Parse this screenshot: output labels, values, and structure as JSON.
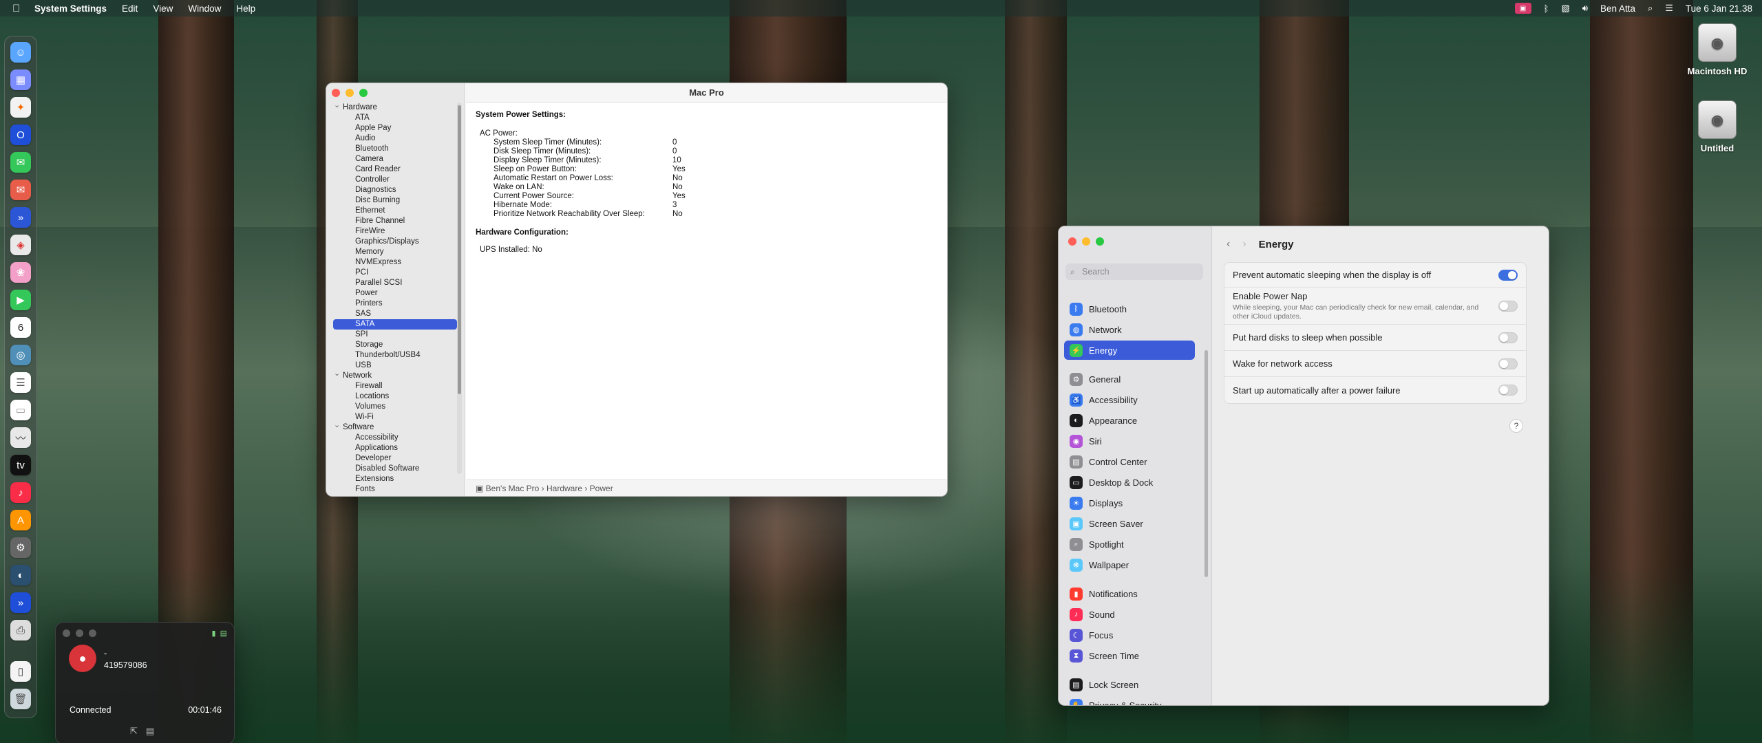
{
  "menubar": {
    "app_name": "System Settings",
    "menus": [
      "Edit",
      "View",
      "Window",
      "Help"
    ],
    "user": "Ben Atta",
    "datetime": "Tue 6 Jan  21.38"
  },
  "desktop": {
    "disks": [
      "Macintosh HD",
      "Untitled"
    ]
  },
  "sysinfo": {
    "title": "Mac Pro",
    "tree": [
      {
        "type": "grp",
        "label": "Hardware"
      },
      {
        "type": "leaf",
        "label": "ATA"
      },
      {
        "type": "leaf",
        "label": "Apple Pay"
      },
      {
        "type": "leaf",
        "label": "Audio"
      },
      {
        "type": "leaf",
        "label": "Bluetooth"
      },
      {
        "type": "leaf",
        "label": "Camera"
      },
      {
        "type": "leaf",
        "label": "Card Reader"
      },
      {
        "type": "leaf",
        "label": "Controller"
      },
      {
        "type": "leaf",
        "label": "Diagnostics"
      },
      {
        "type": "leaf",
        "label": "Disc Burning"
      },
      {
        "type": "leaf",
        "label": "Ethernet"
      },
      {
        "type": "leaf",
        "label": "Fibre Channel"
      },
      {
        "type": "leaf",
        "label": "FireWire"
      },
      {
        "type": "leaf",
        "label": "Graphics/Displays"
      },
      {
        "type": "leaf",
        "label": "Memory"
      },
      {
        "type": "leaf",
        "label": "NVMExpress"
      },
      {
        "type": "leaf",
        "label": "PCI"
      },
      {
        "type": "leaf",
        "label": "Parallel SCSI"
      },
      {
        "type": "leaf",
        "label": "Power"
      },
      {
        "type": "leaf",
        "label": "Printers"
      },
      {
        "type": "leaf",
        "label": "SAS"
      },
      {
        "type": "leaf",
        "label": "SATA",
        "selected": true
      },
      {
        "type": "leaf",
        "label": "SPI"
      },
      {
        "type": "leaf",
        "label": "Storage"
      },
      {
        "type": "leaf",
        "label": "Thunderbolt/USB4"
      },
      {
        "type": "leaf",
        "label": "USB"
      },
      {
        "type": "grp",
        "label": "Network"
      },
      {
        "type": "leaf",
        "label": "Firewall"
      },
      {
        "type": "leaf",
        "label": "Locations"
      },
      {
        "type": "leaf",
        "label": "Volumes"
      },
      {
        "type": "leaf",
        "label": "Wi-Fi"
      },
      {
        "type": "grp",
        "label": "Software"
      },
      {
        "type": "leaf",
        "label": "Accessibility"
      },
      {
        "type": "leaf",
        "label": "Applications"
      },
      {
        "type": "leaf",
        "label": "Developer"
      },
      {
        "type": "leaf",
        "label": "Disabled Software"
      },
      {
        "type": "leaf",
        "label": "Extensions"
      },
      {
        "type": "leaf",
        "label": "Fonts"
      }
    ],
    "heading1": "System Power Settings:",
    "ac_label": "AC Power:",
    "ac": [
      {
        "k": "System Sleep Timer (Minutes):",
        "v": "0"
      },
      {
        "k": "Disk Sleep Timer (Minutes):",
        "v": "0"
      },
      {
        "k": "Display Sleep Timer (Minutes):",
        "v": "10"
      },
      {
        "k": "Sleep on Power Button:",
        "v": "Yes"
      },
      {
        "k": "Automatic Restart on Power Loss:",
        "v": "No"
      },
      {
        "k": "Wake on LAN:",
        "v": "No"
      },
      {
        "k": "Current Power Source:",
        "v": "Yes"
      },
      {
        "k": "Hibernate Mode:",
        "v": "3"
      },
      {
        "k": "Prioritize Network Reachability Over Sleep:",
        "v": "No"
      }
    ],
    "heading2": "Hardware Configuration:",
    "ups": "UPS Installed:   No",
    "path": "Ben's Mac Pro  ›  Hardware  ›  Power"
  },
  "settings": {
    "search_placeholder": "Search",
    "title": "Energy",
    "nav": [
      {
        "label": "Bluetooth",
        "color": "#3a7bf0",
        "icon": "bluetooth-icon",
        "glyph": "ᛒ"
      },
      {
        "label": "Network",
        "color": "#3a7bf0",
        "icon": "globe-icon",
        "glyph": "◍"
      },
      {
        "label": "Energy",
        "color": "#34c759",
        "icon": "energy-icon",
        "glyph": "⚡",
        "selected": true
      },
      {
        "label": "General",
        "color": "#8e8e93",
        "icon": "gear-icon",
        "glyph": "⚙"
      },
      {
        "label": "Accessibility",
        "color": "#3a7bf0",
        "icon": "accessibility-icon",
        "glyph": "♿"
      },
      {
        "label": "Appearance",
        "color": "#1c1c1e",
        "icon": "appearance-icon",
        "glyph": "◐"
      },
      {
        "label": "Siri",
        "color": "#b455d8",
        "icon": "siri-icon",
        "glyph": "◉"
      },
      {
        "label": "Control Center",
        "color": "#8e8e93",
        "icon": "control-center-icon",
        "glyph": "▤"
      },
      {
        "label": "Desktop & Dock",
        "color": "#1c1c1e",
        "icon": "dock-icon",
        "glyph": "▭"
      },
      {
        "label": "Displays",
        "color": "#3a7bf0",
        "icon": "displays-icon",
        "glyph": "☀"
      },
      {
        "label": "Screen Saver",
        "color": "#5ac8fa",
        "icon": "screen-saver-icon",
        "glyph": "▣"
      },
      {
        "label": "Spotlight",
        "color": "#8e8e93",
        "icon": "spotlight-icon",
        "glyph": "⌕"
      },
      {
        "label": "Wallpaper",
        "color": "#5ac8fa",
        "icon": "wallpaper-icon",
        "glyph": "❋"
      },
      {
        "label": "Notifications",
        "color": "#ff3b30",
        "icon": "notifications-icon",
        "glyph": "▮"
      },
      {
        "label": "Sound",
        "color": "#ff2d55",
        "icon": "sound-icon",
        "glyph": "♪"
      },
      {
        "label": "Focus",
        "color": "#5856d6",
        "icon": "focus-icon",
        "glyph": "☾"
      },
      {
        "label": "Screen Time",
        "color": "#5856d6",
        "icon": "hourglass-icon",
        "glyph": "⧗"
      },
      {
        "label": "Lock Screen",
        "color": "#1c1c1e",
        "icon": "lock-screen-icon",
        "glyph": "▤"
      },
      {
        "label": "Privacy & Security",
        "color": "#3a7bf0",
        "icon": "hand-icon",
        "glyph": "✋"
      }
    ],
    "rows": [
      {
        "label": "Prevent automatic sleeping when the display is off",
        "sub": "",
        "on": true
      },
      {
        "label": "Enable Power Nap",
        "sub": "While sleeping, your Mac can periodically check for new email, calendar, and other iCloud updates.",
        "on": false
      },
      {
        "label": "Put hard disks to sleep when possible",
        "sub": "",
        "on": false
      },
      {
        "label": "Wake for network access",
        "sub": "",
        "on": false
      },
      {
        "label": "Start up automatically after a power failure",
        "sub": "",
        "on": false
      }
    ],
    "help": "?"
  },
  "call": {
    "name": "-",
    "number": "419579086",
    "state": "Connected",
    "timer": "00:01:46"
  }
}
